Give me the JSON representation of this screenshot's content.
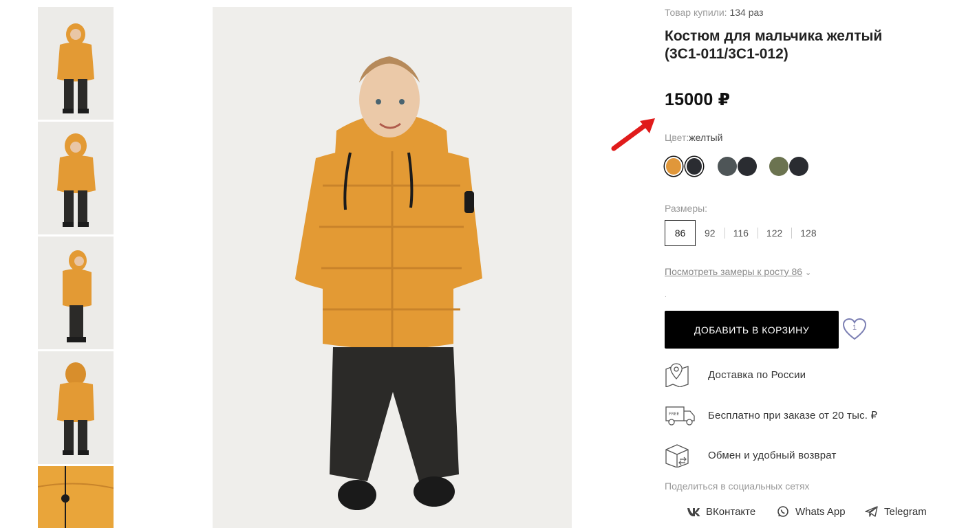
{
  "product": {
    "purchased_label": "Товар купили:",
    "purchased_count": "134 раз",
    "title": "Костюм для мальчика желтый (3С1-011/3С1-012)",
    "price": "15000 ₽",
    "color_label": "Цвет:",
    "color_value": "желтый",
    "swatches": [
      {
        "colors": [
          "#e0973a",
          "#2a2c31"
        ],
        "active": true
      },
      {
        "colors": [
          "#4e5557",
          "#2a2c31"
        ],
        "active": false
      },
      {
        "colors": [
          "#6b7350",
          "#2a2c31"
        ],
        "active": false
      }
    ],
    "sizes_label": "Размеры:",
    "sizes": [
      "86",
      "92",
      "116",
      "122",
      "128"
    ],
    "selected_size": "86",
    "measure_link": "Посмотреть замеры к росту 86",
    "dot": ".",
    "add_to_cart": "ДОБАВИТЬ В КОРЗИНУ",
    "favorites_count": "1"
  },
  "features": [
    {
      "icon": "map-pin-icon",
      "text": "Доставка по России"
    },
    {
      "icon": "delivery-truck-icon",
      "text": "Бесплатно при заказе от 20 тыс. ₽"
    },
    {
      "icon": "return-box-icon",
      "text": "Обмен и удобный возврат"
    }
  ],
  "share": {
    "label": "Поделиться в социальных сетях",
    "networks": [
      {
        "icon": "vk-icon",
        "label": "ВКонтакте"
      },
      {
        "icon": "whatsapp-icon",
        "label": "Whats App"
      },
      {
        "icon": "telegram-icon",
        "label": "Telegram"
      }
    ]
  },
  "colors": {
    "jacket": "#e39a34",
    "pants": "#2b2a28",
    "arrow": "#e01b1b",
    "button_bg": "#000000"
  }
}
